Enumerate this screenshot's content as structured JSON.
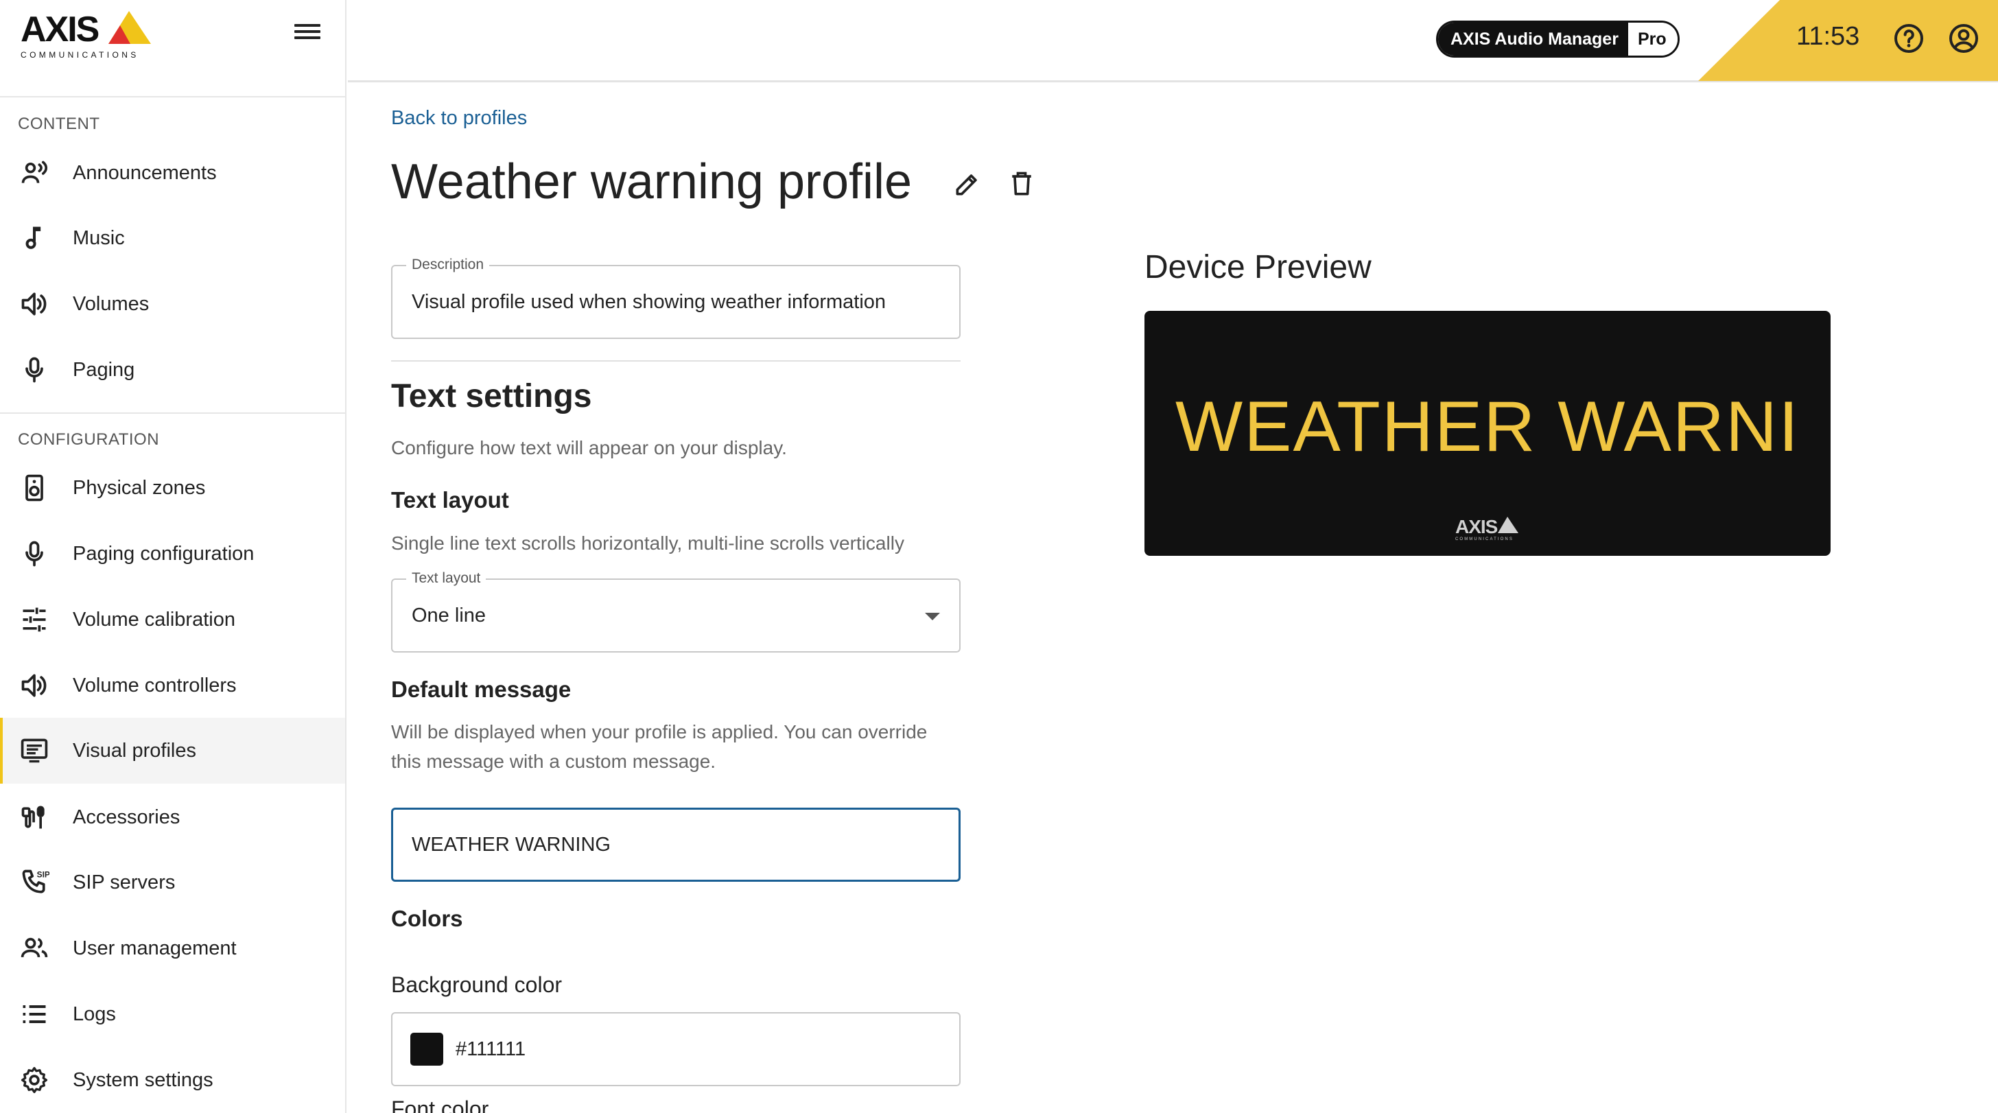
{
  "brand": {
    "logo_main": "AXIS",
    "logo_sub": "COMMUNICATIONS",
    "product_name": "AXIS Audio Manager",
    "product_tier": "Pro"
  },
  "header": {
    "time": "11:53"
  },
  "sidebar": {
    "content_label": "CONTENT",
    "config_label": "CONFIGURATION",
    "content_items": [
      {
        "label": "Announcements",
        "icon": "announcement-icon"
      },
      {
        "label": "Music",
        "icon": "music-note-icon"
      },
      {
        "label": "Volumes",
        "icon": "speaker-icon"
      },
      {
        "label": "Paging",
        "icon": "microphone-icon"
      }
    ],
    "config_items": [
      {
        "label": "Physical zones",
        "icon": "speaker-device-icon"
      },
      {
        "label": "Paging configuration",
        "icon": "microphone-icon"
      },
      {
        "label": "Volume calibration",
        "icon": "sliders-icon"
      },
      {
        "label": "Volume controllers",
        "icon": "speaker-icon"
      },
      {
        "label": "Visual profiles",
        "icon": "display-icon",
        "active": true
      },
      {
        "label": "Accessories",
        "icon": "accessories-icon"
      },
      {
        "label": "SIP servers",
        "icon": "sip-phone-icon"
      },
      {
        "label": "User management",
        "icon": "users-icon"
      },
      {
        "label": "Logs",
        "icon": "list-icon"
      },
      {
        "label": "System settings",
        "icon": "gear-icon"
      }
    ]
  },
  "main": {
    "back_link": "Back to profiles",
    "title": "Weather warning profile",
    "description": {
      "label": "Description",
      "value": "Visual profile used when showing weather information"
    },
    "text_settings": {
      "heading": "Text settings",
      "subtitle": "Configure how text will appear on your display."
    },
    "text_layout": {
      "heading": "Text layout",
      "subtitle": "Single line text scrolls horizontally, multi-line scrolls vertically",
      "field_label": "Text layout",
      "value": "One line"
    },
    "default_message": {
      "heading": "Default message",
      "subtitle_line1": "Will be displayed when your profile is applied. You can override",
      "subtitle_line2": "this message with a custom message.",
      "value": "WEATHER WARNING"
    },
    "colors": {
      "heading": "Colors",
      "background_label": "Background color",
      "background_value": "#111111",
      "font_label": "Font color"
    }
  },
  "preview": {
    "title": "Device Preview",
    "display_text": "WEATHER WARNI",
    "text_color": "#f0c541",
    "background": "#111111",
    "logo_main": "AXIS",
    "logo_sub": "COMMUNICATIONS"
  },
  "colors": {
    "accent_yellow": "#f0c541",
    "link_blue": "#1a5f94",
    "focus_blue": "#1a5f94"
  }
}
